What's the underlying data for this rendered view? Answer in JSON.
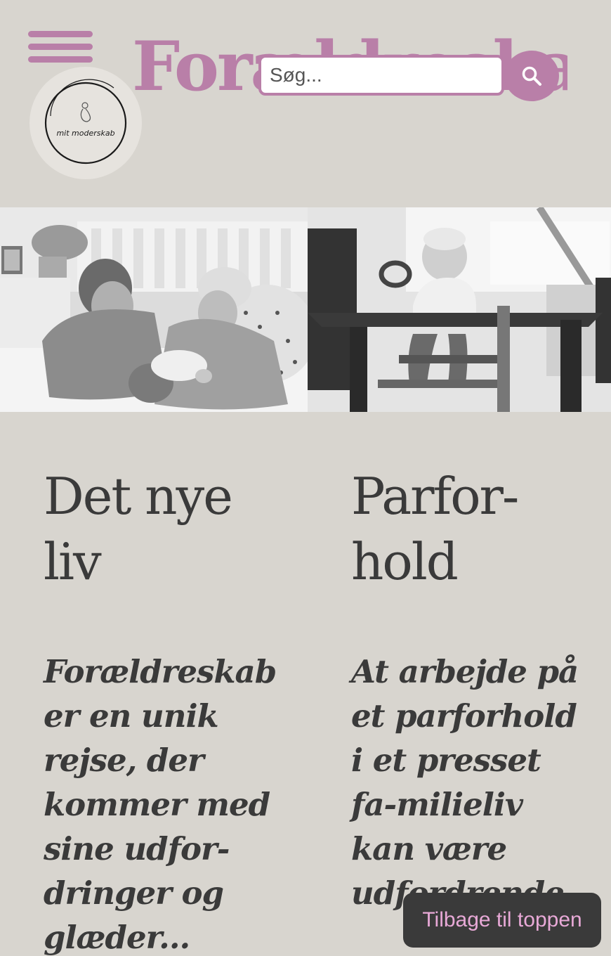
{
  "header": {
    "site_title": "Forældreskab",
    "logo_text": "mit moderskab",
    "search": {
      "placeholder": "Søg..."
    }
  },
  "articles": [
    {
      "title_line1": "Det nye",
      "title_line2": "liv",
      "excerpt": "Forældreskab er en unik rejse, der kommer med sine udfor-dringer og glæder..."
    },
    {
      "title_line1": "Parfor-",
      "title_line2": "hold",
      "excerpt": "At arbejde på et parforhold i et presset fa-milieliv kan være udfordrende..."
    }
  ],
  "back_to_top_label": "Tilbage til toppen",
  "colors": {
    "accent": "#b97fa8",
    "background": "#d8d5cf",
    "text": "#3a3a3a",
    "button_bg": "#3a3a3a",
    "button_text": "#e8a9d7"
  },
  "icons": [
    "hamburger-menu-icon",
    "search-icon",
    "logo-icon"
  ]
}
